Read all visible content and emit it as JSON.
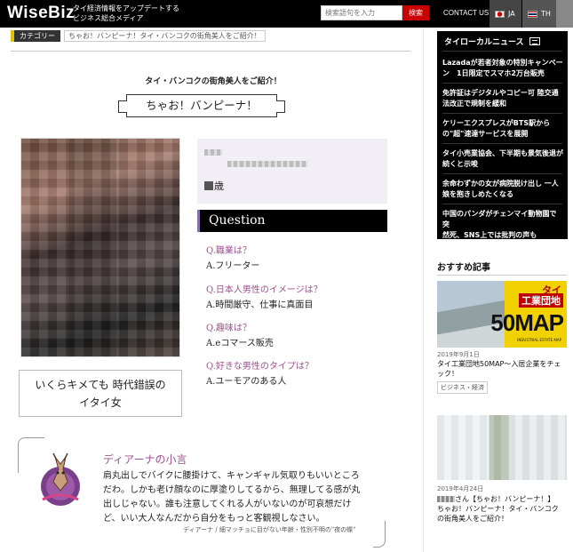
{
  "header": {
    "logo": "WiseBiz",
    "tagline_line1": "タイ経済情報をアップデートする",
    "tagline_line2": "ビジネス総合メディア",
    "search_placeholder": "検索語句を入力",
    "search_button": "検索",
    "contact": "CONTACT US",
    "lang_ja": "JA",
    "lang_th": "TH"
  },
  "breadcrumb": {
    "category": "カテゴリー",
    "text": "ちゃお！バンピーナ！タイ・バンコクの街角美人をご紹介！"
  },
  "article": {
    "kicker": "タイ・バンコクの街角美人をご紹介！",
    "title": "ちゃお！バンピーナ！",
    "caption_line1": "いくらキメても 時代錯誤の",
    "caption_line2": "イタイ女",
    "age_suffix": "歳",
    "question_label": "Question",
    "qa": [
      {
        "q": "Q.職業は？",
        "a": "A.フリーター"
      },
      {
        "q": "Q.日本人男性のイメージは？",
        "a": "A.時間厳守、仕事に真面目"
      },
      {
        "q": "Q.趣味は？",
        "a": "A.eコマース販売"
      },
      {
        "q": "Q.好きな男性のタイプは？",
        "a": "A.ユーモアのある人"
      }
    ],
    "comment_title": "ディアーナの小言",
    "comment_body": "肩丸出しでバイクに腰掛けて、キャンギャル気取りもいいところだわ。しかも老け顔なのに厚塗りしてるから、無理してる感が丸出しじゃない。誰も注意してくれる人がいないのが可哀想だけど、いい大人なんだから自分をもっと客観視しなさい。",
    "comment_sign": "ディアーナ / 細マッチョに目がない年齢・性別不明の\"夜の蝶\""
  },
  "sidebar": {
    "news_heading": "タイローカルニュース",
    "news": [
      {
        "line1": "Lazadaが若者対象の特別キャンペー",
        "line2": "ン　1日限定でスマホ2万台販売"
      },
      {
        "line1": "免許証はデジタルやコピー可 陸交通",
        "line2": "法改正で規制を緩和"
      },
      {
        "line1": "ケリーエクスプレスがBTS駅から",
        "line2": "の\"超\"速達サービスを展開"
      },
      {
        "line1": "タイ小売業協会、下半期も景気後退が",
        "line2": "続くと示唆"
      },
      {
        "line1": "余命わずかの女が病院脱け出し 一人",
        "line2": "娘を抱きしめたくなる"
      },
      {
        "line1": "中国のパンダがチェンマイ動物園で突",
        "line2": "然死、SNS上では批判の声も"
      }
    ],
    "recommended_heading": "おすすめ記事",
    "rec1": {
      "badge_tai": "タイ",
      "badge_label": "工業団地",
      "badge_map": "50MAP",
      "badge_sub": "INDUSTRIAL ESTATE MAP",
      "date": "2019年9月1日",
      "title": "タイ工業団地50MAP〜入居企業をチェック！",
      "tag": "ビジネス・経済"
    },
    "rec2": {
      "date": "2019年4月24日",
      "title_suffix": "さん【ちゃお！バンピーナ！】",
      "title_line2": "ちゃお！バンピーナ！タイ・バンコク",
      "title_line3": "の街角美人をご紹介！"
    }
  }
}
